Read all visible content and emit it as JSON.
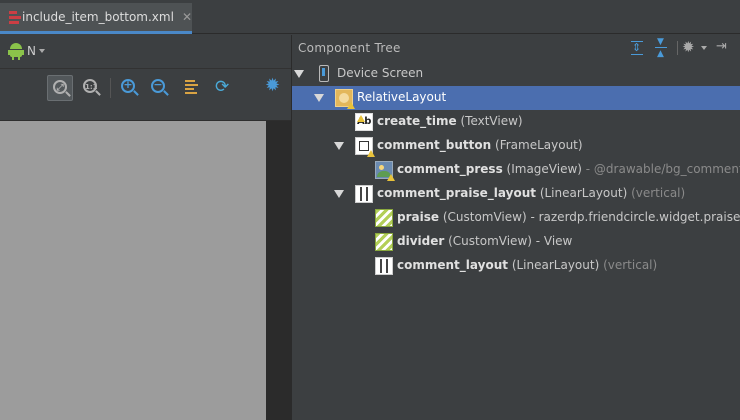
{
  "tab": {
    "title": "include_item_bottom.xml",
    "close_glyph": "✕",
    "icon": "xml-layout-icon",
    "accent_color": "#4a88c7"
  },
  "design_toolbar": {
    "api_level": "N",
    "android_icon": "android-icon",
    "buttons": [
      {
        "name": "zoom-to-fit-button",
        "icon": "zoom-fit-icon",
        "active": true
      },
      {
        "name": "zoom-actual-size-button",
        "icon": "zoom-actual-icon",
        "label": "1:1"
      },
      {
        "name": "zoom-in-button",
        "icon": "zoom-in-icon",
        "label": "+"
      },
      {
        "name": "zoom-out-button",
        "icon": "zoom-out-icon",
        "label": "−"
      },
      {
        "name": "align-button",
        "icon": "align-icon"
      },
      {
        "name": "refresh-button",
        "icon": "refresh-icon",
        "glyph": "⟳"
      },
      {
        "name": "settings-button",
        "icon": "gear-icon",
        "glyph": "✹"
      }
    ]
  },
  "component_tree": {
    "title": "Component Tree",
    "header_icons": [
      "expand-all-icon",
      "collapse-all-icon",
      "gear-icon",
      "hide-panel-icon"
    ],
    "gear_glyph": "✹",
    "hide_glyph": "⇥",
    "selection_color": "#4b6eaf",
    "nodes": [
      {
        "name": "Device Screen",
        "type": "",
        "detail": "",
        "extra": "",
        "icon": "device-icon",
        "expanded": true,
        "selected": false
      },
      {
        "name": "RelativeLayout",
        "type": "",
        "detail": "",
        "extra": "",
        "icon": "relativelayout-icon",
        "expanded": true,
        "selected": true
      },
      {
        "name": "create_time",
        "type": "(TextView)",
        "detail": "",
        "extra": "",
        "icon": "textview-icon",
        "icon_text": "Ab"
      },
      {
        "name": "comment_button",
        "type": "(FrameLayout)",
        "detail": "",
        "extra": "",
        "icon": "framelayout-icon",
        "expanded": true
      },
      {
        "name": "comment_press",
        "type": "(ImageView)",
        "detail": " - @drawable/bg_comment_press",
        "extra": "",
        "icon": "imageview-icon"
      },
      {
        "name": "comment_praise_layout",
        "type": "(LinearLayout)",
        "detail": "",
        "extra": " (vertical)",
        "icon": "linearlayout-icon",
        "expanded": true
      },
      {
        "name": "praise",
        "type": "(CustomView)",
        "detail": " - razerdp.friendcircle.widget.praisewidget.PraiseWidget",
        "extra": "",
        "icon": "customview-icon"
      },
      {
        "name": "divider",
        "type": "(CustomView)",
        "detail": " - View",
        "extra": "",
        "icon": "customview-icon"
      },
      {
        "name": "comment_layout",
        "type": "(LinearLayout)",
        "detail": "",
        "extra": " (vertical)",
        "icon": "linearlayout-icon"
      }
    ]
  }
}
